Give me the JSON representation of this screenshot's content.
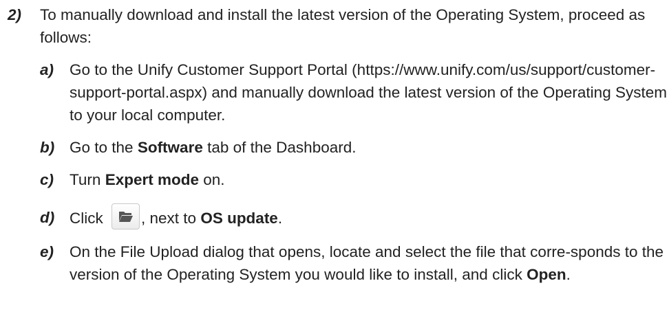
{
  "step": {
    "number": "2)",
    "intro": "To manually download and install the latest version of the Operating System, proceed as follows:"
  },
  "substeps": {
    "a": {
      "letter": "a)",
      "text": "Go to the Unify Customer Support Portal (https://www.unify.com/us/support/customer-support-portal.aspx) and manually download the latest version of the Operating System to your local computer."
    },
    "b": {
      "letter": "b)",
      "pre": "Go to the ",
      "bold": "Software",
      "post": " tab of the Dashboard."
    },
    "c": {
      "letter": "c)",
      "pre": "Turn ",
      "bold": "Expert mode",
      "post": " on."
    },
    "d": {
      "letter": "d)",
      "pre": "Click ",
      "icon": "folder-open-icon",
      "mid": ", next to ",
      "bold": "OS update",
      "post": "."
    },
    "e": {
      "letter": "e)",
      "pre": "On the File Upload dialog that opens, locate and select the file that corre-sponds to the version of the Operating System you would like to install, and click ",
      "bold": "Open",
      "post": "."
    }
  }
}
